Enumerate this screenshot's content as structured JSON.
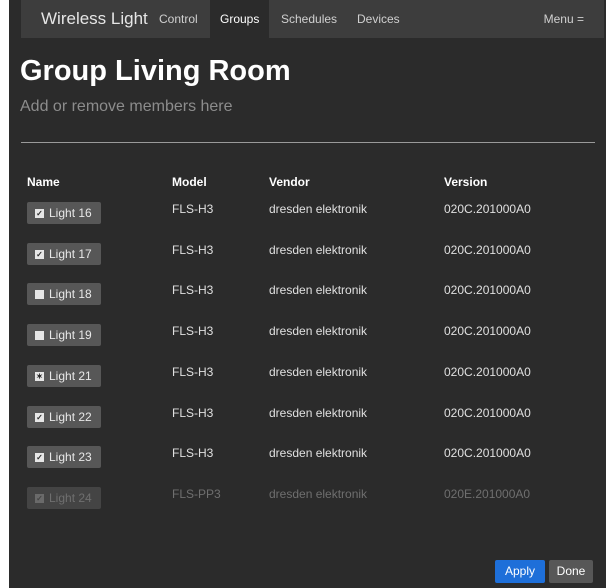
{
  "navbar": {
    "brand": "Wireless Light",
    "tabs": [
      {
        "label": "Control"
      },
      {
        "label": "Groups"
      },
      {
        "label": "Schedules"
      },
      {
        "label": "Devices"
      }
    ],
    "menu_label": "Menu ="
  },
  "page": {
    "title": "Group Living Room",
    "subtitle": "Add or remove members here"
  },
  "table": {
    "headers": {
      "name": "Name",
      "model": "Model",
      "vendor": "Vendor",
      "version": "Version"
    },
    "rows": [
      {
        "name": "Light 16",
        "model": "FLS-H3",
        "vendor": "dresden elektronik",
        "version": "020C.201000A0",
        "checked": "checked"
      },
      {
        "name": "Light 17",
        "model": "FLS-H3",
        "vendor": "dresden elektronik",
        "version": "020C.201000A0",
        "checked": "checked"
      },
      {
        "name": "Light 18",
        "model": "FLS-H3",
        "vendor": "dresden elektronik",
        "version": "020C.201000A0",
        "checked": "unchecked"
      },
      {
        "name": "Light 19",
        "model": "FLS-H3",
        "vendor": "dresden elektronik",
        "version": "020C.201000A0",
        "checked": "unchecked"
      },
      {
        "name": "Light 21",
        "model": "FLS-H3",
        "vendor": "dresden elektronik",
        "version": "020C.201000A0",
        "checked": "indeterminate"
      },
      {
        "name": "Light 22",
        "model": "FLS-H3",
        "vendor": "dresden elektronik",
        "version": "020C.201000A0",
        "checked": "checked"
      },
      {
        "name": "Light 23",
        "model": "FLS-H3",
        "vendor": "dresden elektronik",
        "version": "020C.201000A0",
        "checked": "checked"
      },
      {
        "name": "Light 24",
        "model": "FLS-PP3",
        "vendor": "dresden elektronik",
        "version": "020E.201000A0",
        "checked": "checked",
        "disabled": true
      }
    ]
  },
  "actions": {
    "apply_label": "Apply",
    "done_label": "Done"
  },
  "colors": {
    "background": "#2b2b2b",
    "navbar": "#3d3d3d",
    "accent": "#1e6fd9",
    "button": "#575757"
  }
}
